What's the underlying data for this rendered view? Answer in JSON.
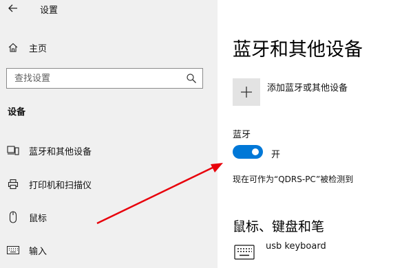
{
  "sidebar": {
    "app_title": "设置",
    "home_label": "主页",
    "search": {
      "placeholder": "查找设置"
    },
    "section_heading": "设备",
    "items": [
      {
        "label": "蓝牙和其他设备",
        "icon": "devices-icon"
      },
      {
        "label": "打印机和扫描仪",
        "icon": "printer-icon"
      },
      {
        "label": "鼠标",
        "icon": "mouse-icon"
      },
      {
        "label": "输入",
        "icon": "keyboard-icon"
      }
    ]
  },
  "main": {
    "title": "蓝牙和其他设备",
    "add_device_label": "添加蓝牙或其他设备",
    "bluetooth_label": "蓝牙",
    "bluetooth_state": "开",
    "bluetooth_on": true,
    "discoverable_text": "现在可作为“QDRS-PC”被检测到",
    "section_heading": "鼠标、键盘和笔",
    "devices": [
      {
        "name": "usb keyboard",
        "icon": "keyboard-icon"
      }
    ]
  },
  "colors": {
    "accent": "#0078d7",
    "sidebar_bg": "#f0f0f0",
    "annotation_arrow": "#e8000b"
  }
}
